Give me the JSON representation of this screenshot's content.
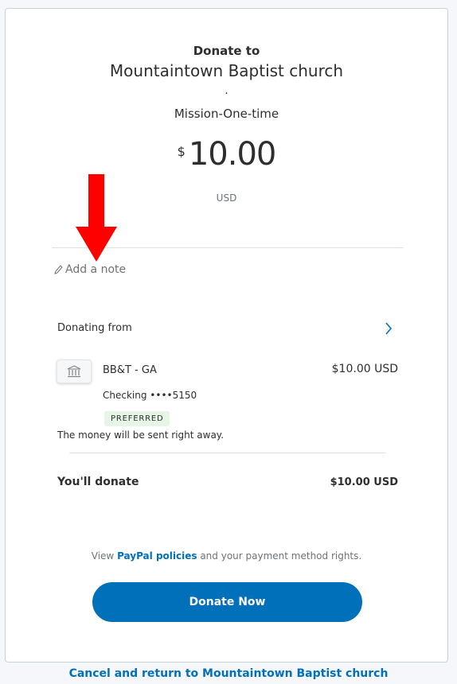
{
  "header": {
    "donate_to": "Donate to",
    "organization": "Mountaintown Baptist church",
    "separator": ".",
    "purpose": "Mission-One-time"
  },
  "amount": {
    "symbol": "$",
    "value": "10.00",
    "currency": "USD"
  },
  "note": {
    "label": "Add a note",
    "icon": "pencil-icon"
  },
  "funding": {
    "section_label": "Donating from",
    "bank_name": "BB&T - GA",
    "bank_amount": "$10.00 USD",
    "account": "Checking ••••5150",
    "badge": "PREFERRED",
    "timing_note": "The money will be sent right away."
  },
  "summary": {
    "label": "You'll donate",
    "amount": "$10.00 USD"
  },
  "policy": {
    "prefix": "View ",
    "link": "PayPal policies",
    "suffix": " and your payment method rights."
  },
  "actions": {
    "donate_button": "Donate Now",
    "cancel_link": "Cancel and return to Mountaintown Baptist church"
  },
  "colors": {
    "accent": "#0070ba",
    "annotation_arrow": "#ff0000",
    "badge_bg": "#e6f5e6"
  }
}
